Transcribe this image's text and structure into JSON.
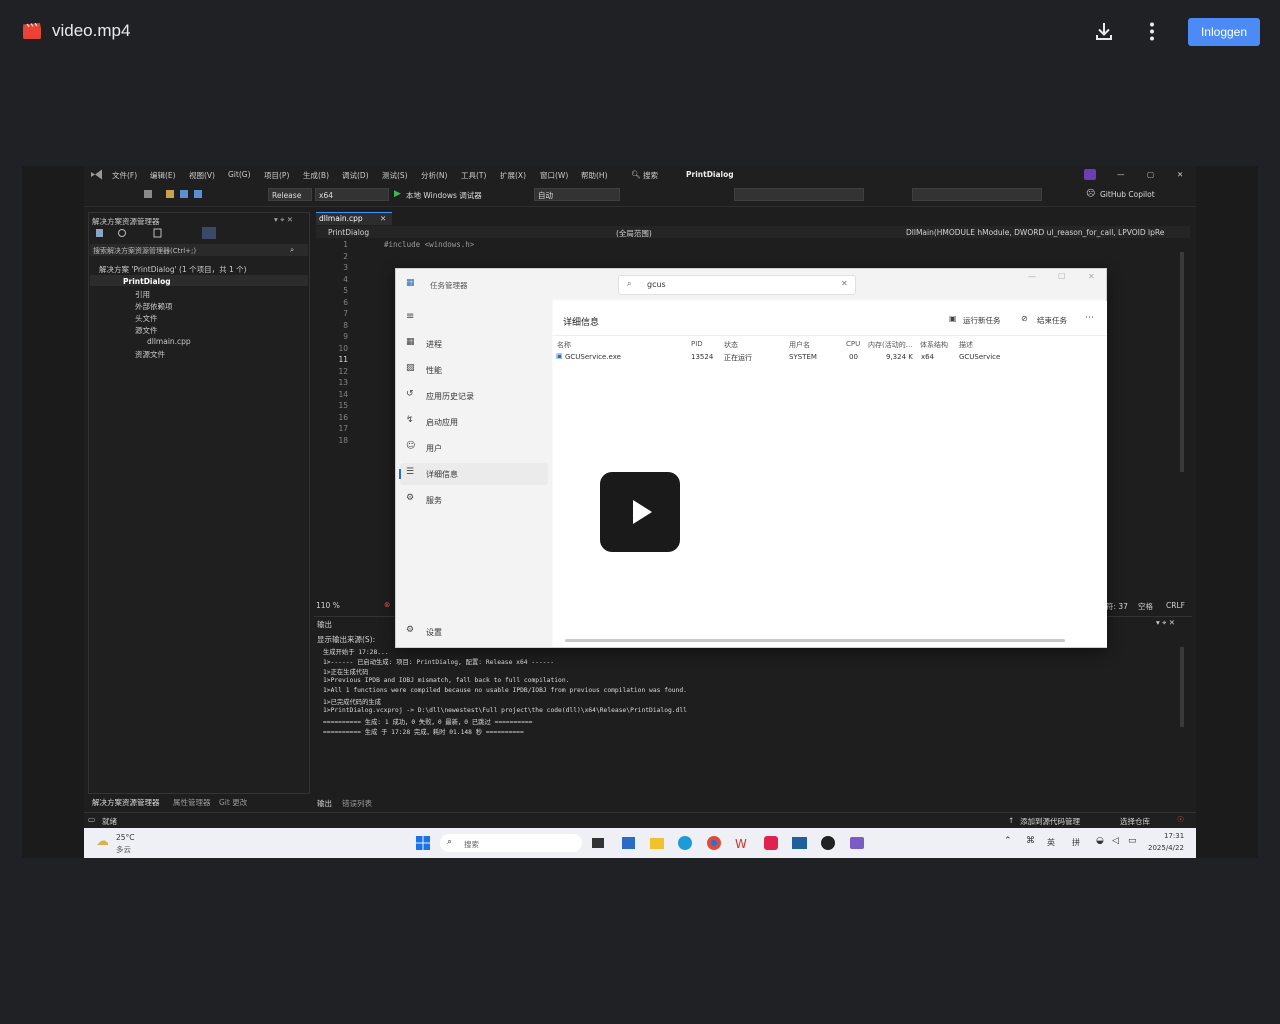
{
  "topbar": {
    "title": "video.mp4",
    "file_icon": "video-file-icon",
    "download_icon": "download-icon",
    "more_icon": "more-vertical-icon",
    "login_label": "Inloggen",
    "accent": "#4c8bf5"
  },
  "vs": {
    "menu": [
      "文件(F)",
      "编辑(E)",
      "视图(V)",
      "Git(G)",
      "项目(P)",
      "生成(B)",
      "调试(D)",
      "测试(S)",
      "分析(N)",
      "工具(T)",
      "扩展(X)",
      "窗口(W)",
      "帮助(H)"
    ],
    "search_label": "搜索",
    "project_title": "PrintDialog",
    "toolbar": {
      "config": "Release",
      "platform": "x64",
      "run_label": "本地 Windows 调试器",
      "auto": "自动",
      "copilot": "GitHub Copilot"
    },
    "solution": {
      "header": "解决方案资源管理器",
      "search_placeholder": "搜索解决方案资源管理器(Ctrl+;)",
      "items": [
        "解决方案 'PrintDialog' (1 个项目，共 1 个)",
        "PrintDialog",
        "引用",
        "外部依赖项",
        "头文件",
        "源文件",
        "dllmain.cpp",
        "资源文件"
      ],
      "bottom_tabs": [
        "解决方案资源管理器",
        "属性管理器",
        "Git 更改"
      ]
    },
    "editor": {
      "tab": "dllmain.cpp",
      "nav_project": "PrintDialog",
      "nav_scope": "(全局范围)",
      "nav_func": "DllMain(HMODULE hModule, DWORD ul_reason_for_call, LPVOID lpRe",
      "line_numbers": [
        "1",
        "2",
        "3",
        "4",
        "5",
        "6",
        "7",
        "8",
        "9",
        "10",
        "11",
        "12",
        "13",
        "14",
        "15",
        "16",
        "17",
        "18"
      ],
      "code_line1": "#include <windows.h>",
      "zoom": "110 %",
      "status_right": [
        "符: 37",
        "空格",
        "CRLF"
      ]
    },
    "output": {
      "header": "输出",
      "source_label": "显示输出来源(S):",
      "lines": [
        "生成开始于 17:28...",
        "1>------ 已启动生成: 项目: PrintDialog, 配置: Release x64 ------",
        "1>正在生成代码",
        "1>Previous IPDB and IOBJ mismatch, fall back to full compilation.",
        "1>All 1 functions were compiled because no usable IPDB/IOBJ from previous compilation was found.",
        "1>已完成代码的生成",
        "1>PrintDialog.vcxproj -> D:\\dll\\newestest\\Full project\\the code(dll)\\x64\\Release\\PrintDialog.dll",
        "========== 生成: 1 成功，0 失败，0 最新，0 已跳过 ==========",
        "========== 生成 于 17:28 完成，耗时 01.148 秒 =========="
      ],
      "bottom_tabs": [
        "输出",
        "错误列表"
      ]
    },
    "statusbar": {
      "left": "就绪",
      "right1": "添加到源代码管理",
      "right2": "选择仓库"
    }
  },
  "taskmgr": {
    "title": "任务管理器",
    "search_value": "gcus",
    "nav": [
      "进程",
      "性能",
      "应用历史记录",
      "启动应用",
      "用户",
      "详细信息",
      "服务"
    ],
    "settings": "设置",
    "section_title": "详细信息",
    "actions": [
      "运行新任务",
      "结束任务"
    ],
    "columns": [
      "名称",
      "PID",
      "状态",
      "用户名",
      "CPU",
      "内存(活动的...",
      "体系结构",
      "描述"
    ],
    "row": [
      "GCUService.exe",
      "13524",
      "正在运行",
      "SYSTEM",
      "00",
      "9,324 K",
      "x64",
      "GCUService"
    ]
  },
  "taskbar": {
    "weather_temp": "25°C",
    "weather_desc": "多云",
    "search_label": "搜索",
    "ime1": "英",
    "ime2": "拼",
    "time": "17:31",
    "date": "2025/4/22"
  },
  "player": {
    "play_icon": "play-icon"
  }
}
